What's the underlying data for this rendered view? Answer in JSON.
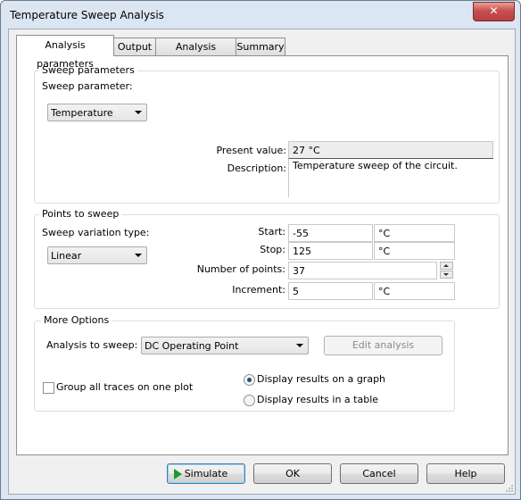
{
  "window": {
    "title": "Temperature Sweep Analysis",
    "close_label": "✕"
  },
  "tabs": [
    {
      "label": "Analysis parameters"
    },
    {
      "label": "Output"
    },
    {
      "label": "Analysis options"
    },
    {
      "label": "Summary"
    }
  ],
  "sweep_parameters": {
    "group_title": "Sweep parameters",
    "sweep_parameter_label": "Sweep parameter:",
    "sweep_parameter_value": "Temperature",
    "present_value_label": "Present value:",
    "present_value": "27 °C",
    "description_label": "Description:",
    "description": "Temperature sweep of the circuit."
  },
  "points_to_sweep": {
    "group_title": "Points to sweep",
    "variation_type_label": "Sweep variation type:",
    "variation_type_value": "Linear",
    "start_label": "Start:",
    "start_value": "-55",
    "start_unit": "°C",
    "stop_label": "Stop:",
    "stop_value": "125",
    "stop_unit": "°C",
    "num_points_label": "Number of points:",
    "num_points_value": "37",
    "increment_label": "Increment:",
    "increment_value": "5",
    "increment_unit": "°C"
  },
  "more_options": {
    "group_title": "More Options",
    "analysis_to_sweep_label": "Analysis to sweep:",
    "analysis_to_sweep_value": "DC Operating Point",
    "edit_analysis_label": "Edit analysis",
    "group_traces_label": "Group all traces on one plot",
    "group_traces_checked": false,
    "display_graph_label": "Display results on a graph",
    "display_table_label": "Display results in a table",
    "display_selected": "graph"
  },
  "buttons": {
    "simulate": "Simulate",
    "ok": "OK",
    "cancel": "Cancel",
    "help": "Help"
  },
  "colors": {
    "simulate_icon": "#1f9a2e",
    "close_button": "#c75050"
  }
}
